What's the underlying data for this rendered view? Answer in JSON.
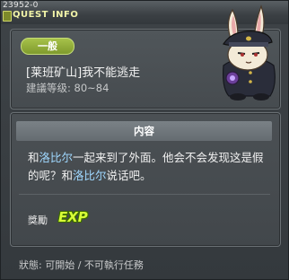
{
  "window": {
    "quest_id": "23952-0",
    "title": "QUEST INFO"
  },
  "quest": {
    "category": "一般",
    "name": "[莱班矿山]我不能逃走",
    "level": "建議等级: 80~84"
  },
  "content": {
    "header": "内容",
    "text_parts": [
      "和",
      "洛比尔",
      "一起来到了外面。他会不会发现这是假的呢？和",
      "洛比尔",
      "说话吧。"
    ]
  },
  "reward": {
    "label": "獎勵",
    "exp": "EXP"
  },
  "status": "狀態: 可開始 / 不可執行任務",
  "colors": {
    "npc_name": "#9fd8ff",
    "category_badge": "#8eac36",
    "title_text": "#f1f3a8"
  }
}
